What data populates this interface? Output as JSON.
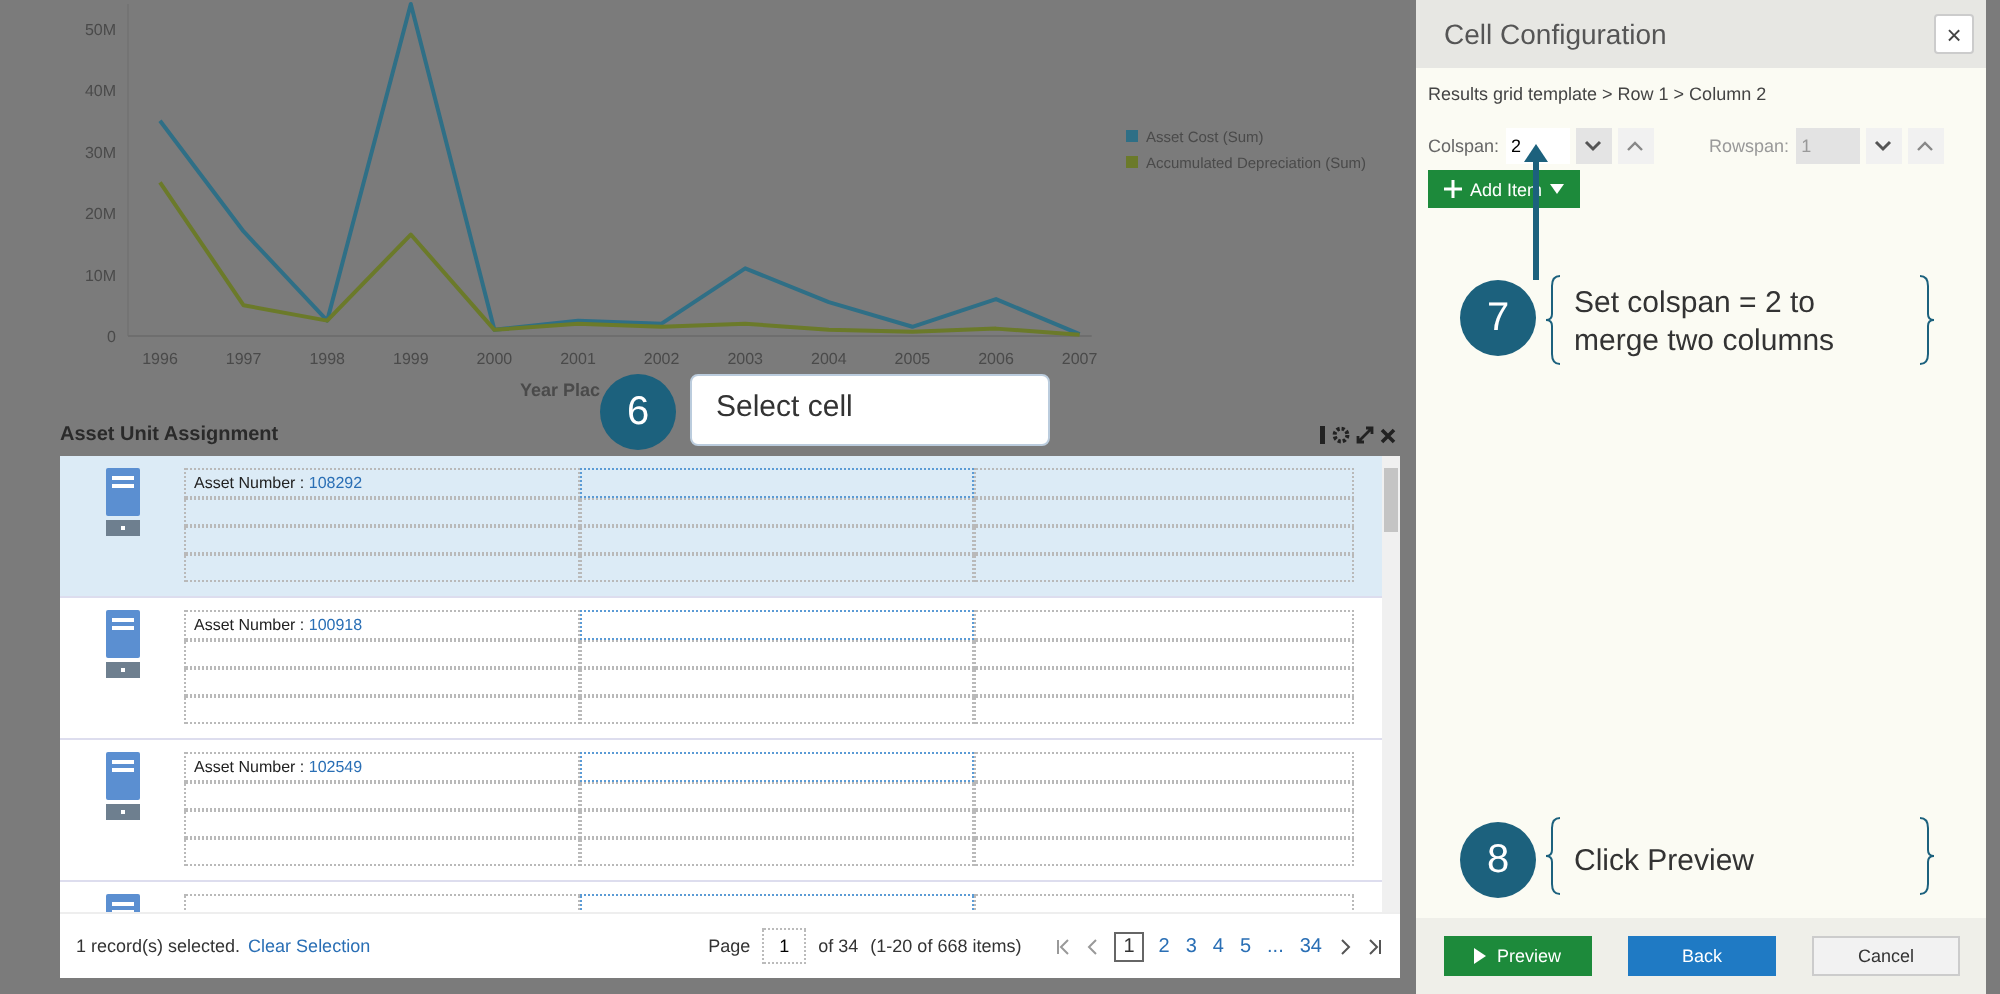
{
  "chart": {
    "chart_data": {
      "type": "line",
      "xlabel": "Year Plac",
      "categories": [
        "1996",
        "1997",
        "1998",
        "1999",
        "2000",
        "2001",
        "2002",
        "2003",
        "2004",
        "2005",
        "2006",
        "2007"
      ],
      "legend": "right",
      "ylim": [
        0,
        54000000
      ],
      "yticks": [
        {
          "value": 0,
          "label": "0"
        },
        {
          "value": 10000000,
          "label": "10M"
        },
        {
          "value": 20000000,
          "label": "20M"
        },
        {
          "value": 30000000,
          "label": "30M"
        },
        {
          "value": 40000000,
          "label": "40M"
        },
        {
          "value": 50000000,
          "label": "50M"
        }
      ],
      "series": [
        {
          "name": "Asset Cost (Sum)",
          "color": "#2f6f86",
          "values": [
            35000000,
            17000000,
            2500000,
            54000000,
            1000000,
            2500000,
            2000000,
            11000000,
            5500000,
            1500000,
            6000000,
            300000
          ]
        },
        {
          "name": "Accumulated Depreciation (Sum)",
          "color": "#6b7a2a",
          "values": [
            25000000,
            5000000,
            2500000,
            16500000,
            1000000,
            2000000,
            1500000,
            2000000,
            1000000,
            700000,
            1200000,
            200000
          ]
        }
      ]
    }
  },
  "grid_panel": {
    "title": "Asset Unit Assignment",
    "rows": [
      {
        "label": "Asset Number :",
        "value": "108292",
        "selected": true
      },
      {
        "label": "Asset Number :",
        "value": "100918",
        "selected": false
      },
      {
        "label": "Asset Number :",
        "value": "102549",
        "selected": false
      }
    ],
    "footer": {
      "selection": "1 record(s) selected.",
      "clear": "Clear Selection",
      "page_label": "Page",
      "page_value": "1",
      "page_of": "of 34",
      "range": "(1-20 of 668 items)",
      "pages": [
        {
          "label": "1",
          "selected": true
        },
        {
          "label": "2",
          "selected": false
        },
        {
          "label": "3",
          "selected": false
        },
        {
          "label": "4",
          "selected": false
        },
        {
          "label": "5",
          "selected": false
        },
        {
          "label": "...",
          "selected": false
        },
        {
          "label": "34",
          "selected": false
        }
      ]
    }
  },
  "cell_config": {
    "title": "Cell Configuration",
    "close": "×",
    "breadcrumb": "Results grid template > Row 1 > Column 2",
    "spans": [
      {
        "label": "Colspan:",
        "value": "2",
        "disabled": false
      },
      {
        "label": "Rowspan:",
        "value": "1",
        "disabled": true
      }
    ],
    "add_item": "Add Item",
    "buttons": [
      {
        "label": "Preview",
        "kind": "play"
      },
      {
        "label": "Back",
        "kind": "primary"
      },
      {
        "label": "Cancel",
        "kind": "plain"
      }
    ]
  },
  "callouts": [
    {
      "number": "6",
      "text": "Select cell",
      "kind": "box"
    },
    {
      "number": "7",
      "text": "Set colspan = 2 to merge two columns",
      "kind": "bracket"
    },
    {
      "number": "8",
      "text": "Click Preview",
      "kind": "bracket"
    }
  ]
}
